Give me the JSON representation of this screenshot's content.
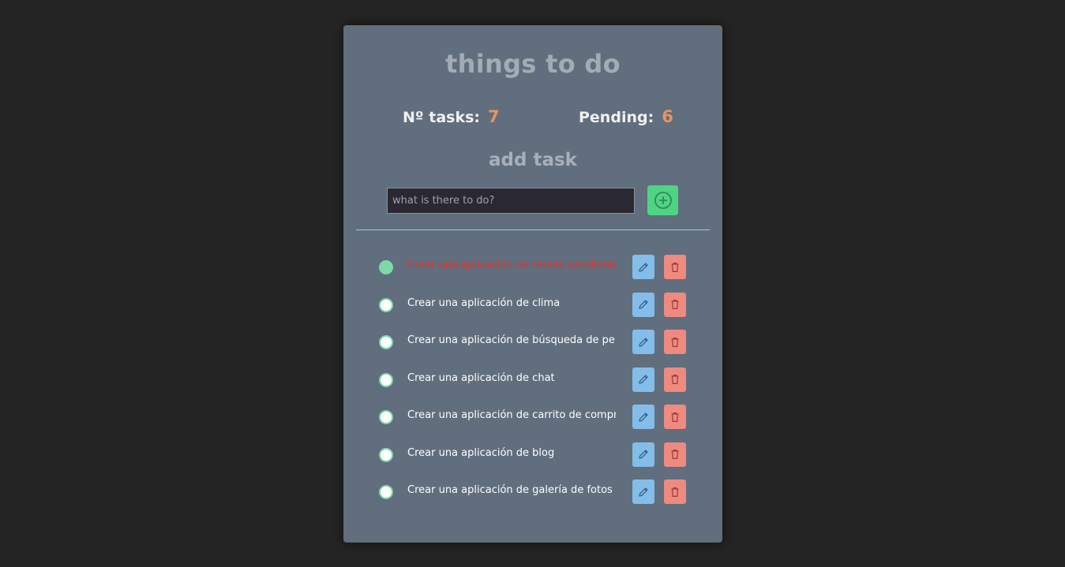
{
  "app": {
    "title": "things to do"
  },
  "stats": {
    "tasks_label": "Nº tasks:",
    "tasks_count": "7",
    "pending_label": "Pending:",
    "pending_count": "6"
  },
  "add_task": {
    "heading": "add task",
    "placeholder": "what is there to do?",
    "value": "",
    "button_icon": "plus-circle-icon"
  },
  "colors": {
    "background": "#242424",
    "card": "#606e7d",
    "accent_count": "#e8955e",
    "add_button": "#4fd486",
    "edit_button": "#84bde9",
    "delete_button": "#ee8a80",
    "done_text": "#e8302d",
    "check": "#7ed9a7"
  },
  "tasks": [
    {
      "text": "Crear una aplicación de tareas pendientes",
      "done": true,
      "edit_icon": "pencil-icon",
      "delete_icon": "trash-icon"
    },
    {
      "text": "Crear una aplicación de clima",
      "done": false,
      "edit_icon": "pencil-icon",
      "delete_icon": "trash-icon"
    },
    {
      "text": "Crear una aplicación de búsqueda de películas",
      "done": false,
      "edit_icon": "pencil-icon",
      "delete_icon": "trash-icon"
    },
    {
      "text": "Crear una aplicación de chat",
      "done": false,
      "edit_icon": "pencil-icon",
      "delete_icon": "trash-icon"
    },
    {
      "text": "Crear una aplicación de carrito de compras",
      "done": false,
      "edit_icon": "pencil-icon",
      "delete_icon": "trash-icon"
    },
    {
      "text": "Crear una aplicación de blog",
      "done": false,
      "edit_icon": "pencil-icon",
      "delete_icon": "trash-icon"
    },
    {
      "text": "Crear una aplicación de galería de fotos",
      "done": false,
      "edit_icon": "pencil-icon",
      "delete_icon": "trash-icon"
    }
  ]
}
